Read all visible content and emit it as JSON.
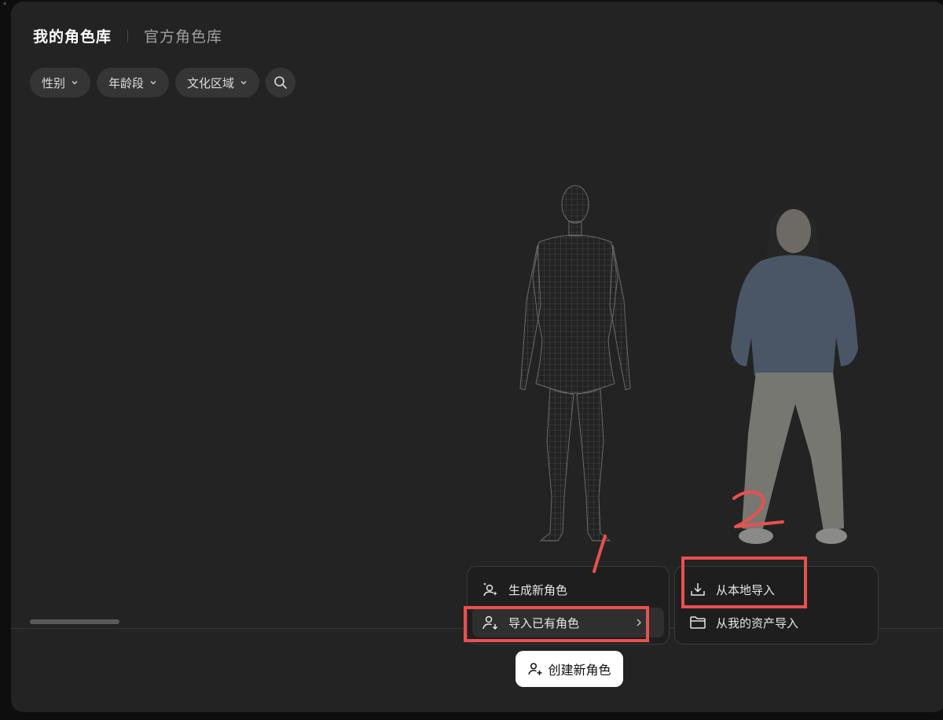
{
  "window": {
    "corner_glyph": "⚬"
  },
  "tabs": [
    {
      "label": "我的角色库",
      "active": true
    },
    {
      "label": "官方角色库",
      "active": false
    }
  ],
  "filters": [
    {
      "label": "性别"
    },
    {
      "label": "年龄段"
    },
    {
      "label": "文化区域"
    }
  ],
  "search": {
    "icon": "search-icon"
  },
  "menu": {
    "items": [
      {
        "label": "生成新角色",
        "icon": "sparkle-person-icon"
      },
      {
        "label": "导入已有角色",
        "icon": "person-import-icon",
        "highlighted": true,
        "has_submenu": true
      }
    ]
  },
  "submenu": {
    "items": [
      {
        "label": "从本地导入",
        "icon": "download-icon"
      },
      {
        "label": "从我的资产导入",
        "icon": "folder-icon"
      }
    ]
  },
  "create_button": {
    "label": "创建新角色",
    "icon": "person-add-icon"
  },
  "annotations": {
    "marker_1": "1",
    "marker_2": "2",
    "color": "#e8504f"
  },
  "colors": {
    "panel": "#232323",
    "chip": "#353535",
    "menu": "#1e1e1e",
    "accent_button": "#ffffff"
  }
}
